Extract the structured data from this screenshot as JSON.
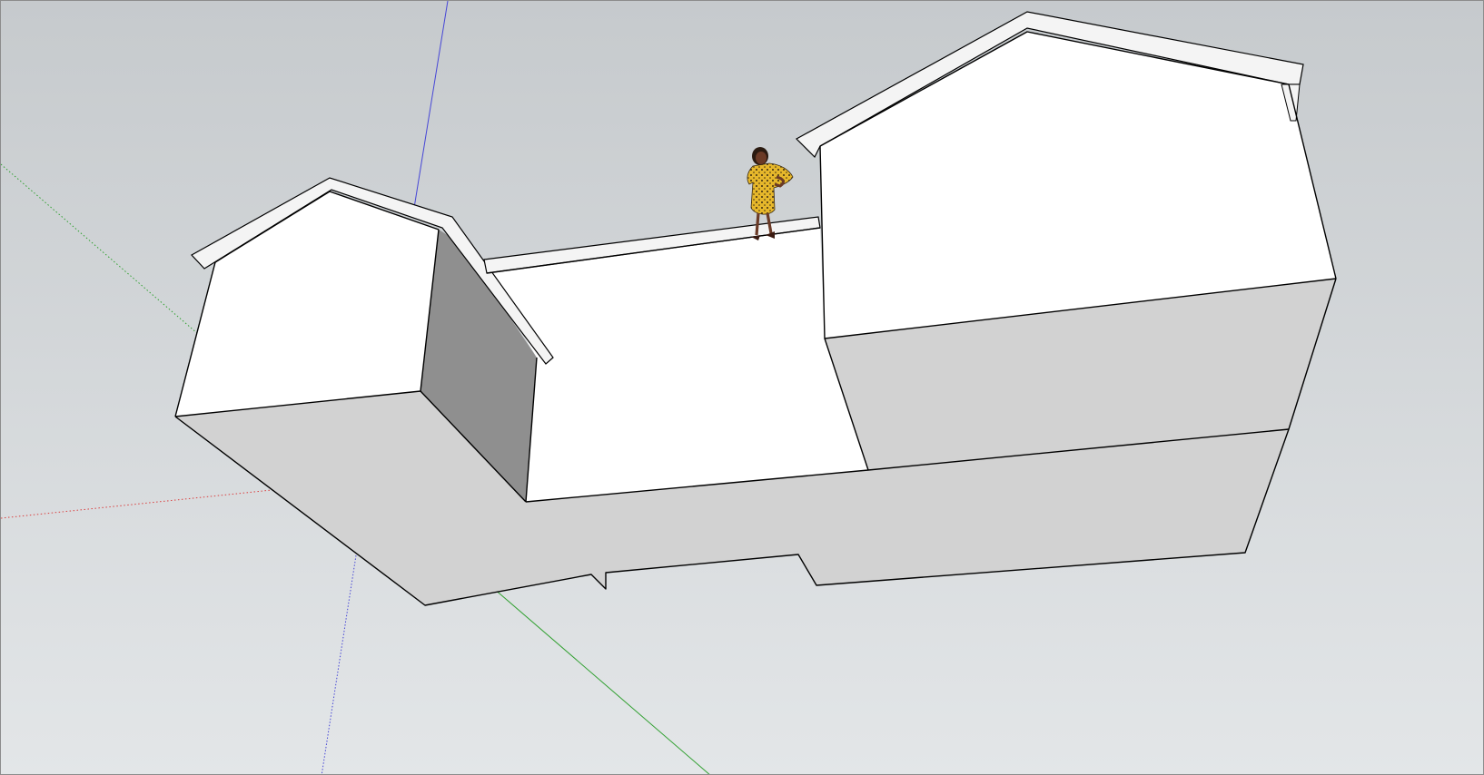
{
  "viewport": {
    "sky_top_color": "#c6cacd",
    "sky_bottom_color": "#e3e6e8",
    "axes": {
      "red_axis_color": "#d94040",
      "green_axis_color": "#30a030",
      "blue_axis_color": "#4646d6"
    },
    "model": {
      "face_front_color": "#ffffff",
      "face_side_color": "#d2d2d2",
      "face_shadow_color": "#8f8f8f",
      "roof_trim_color": "#f4f4f4",
      "edge_color": "#000000"
    },
    "scale_figure": {
      "icon": "person-figure-icon",
      "dress_color": "#e6b72b",
      "skin_color": "#6b3a26"
    }
  }
}
